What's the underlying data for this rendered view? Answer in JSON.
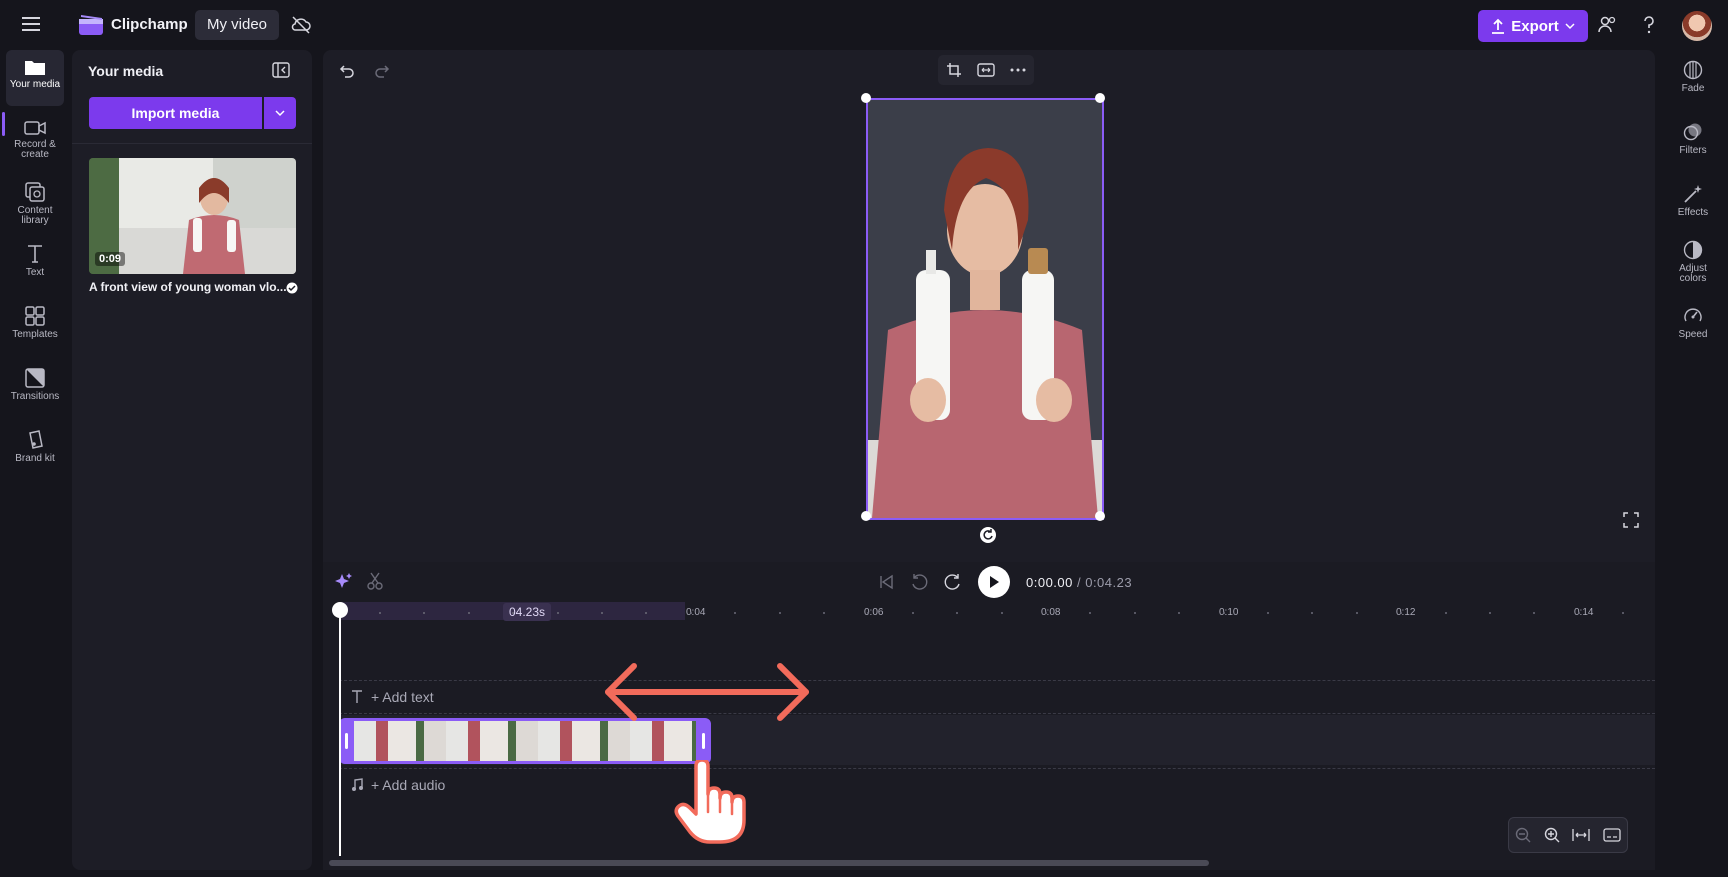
{
  "topbar": {
    "brand_name": "Clipchamp",
    "project_title": "My video",
    "export_label": "Export"
  },
  "left_rail": {
    "items": [
      {
        "label": "Your media",
        "icon": "folder-icon",
        "active": true
      },
      {
        "label": "Record &\ncreate",
        "icon": "camera-icon"
      },
      {
        "label": "Content\nlibrary",
        "icon": "library-icon"
      },
      {
        "label": "Text",
        "icon": "text-icon"
      },
      {
        "label": "Templates",
        "icon": "templates-icon"
      },
      {
        "label": "Transitions",
        "icon": "transitions-icon"
      },
      {
        "label": "Brand kit",
        "icon": "brand-kit-icon"
      }
    ]
  },
  "media_panel": {
    "title": "Your media",
    "import_label": "Import media",
    "items": [
      {
        "duration": "0:09",
        "caption": "A front view of young woman vlo..."
      }
    ]
  },
  "timeline": {
    "current_time": "0:00.00",
    "separator": " / ",
    "total_time": "0:04.23",
    "clip_duration_badge": "04.23s",
    "ruler_labels": [
      "0:04",
      "0:06",
      "0:08",
      "0:10",
      "0:12",
      "0:14"
    ],
    "add_text_label": "+ Add text",
    "add_audio_label": "+ Add audio"
  },
  "right_rail": {
    "items": [
      {
        "label": "Fade",
        "icon": "fade-icon"
      },
      {
        "label": "Filters",
        "icon": "filters-icon"
      },
      {
        "label": "Effects",
        "icon": "effects-icon"
      },
      {
        "label": "Adjust\ncolors",
        "icon": "adjust-colors-icon"
      },
      {
        "label": "Speed",
        "icon": "speed-icon"
      }
    ]
  },
  "colors": {
    "accent": "#7c3aed",
    "annotation": "#f26b5b",
    "background": "#15151c"
  }
}
